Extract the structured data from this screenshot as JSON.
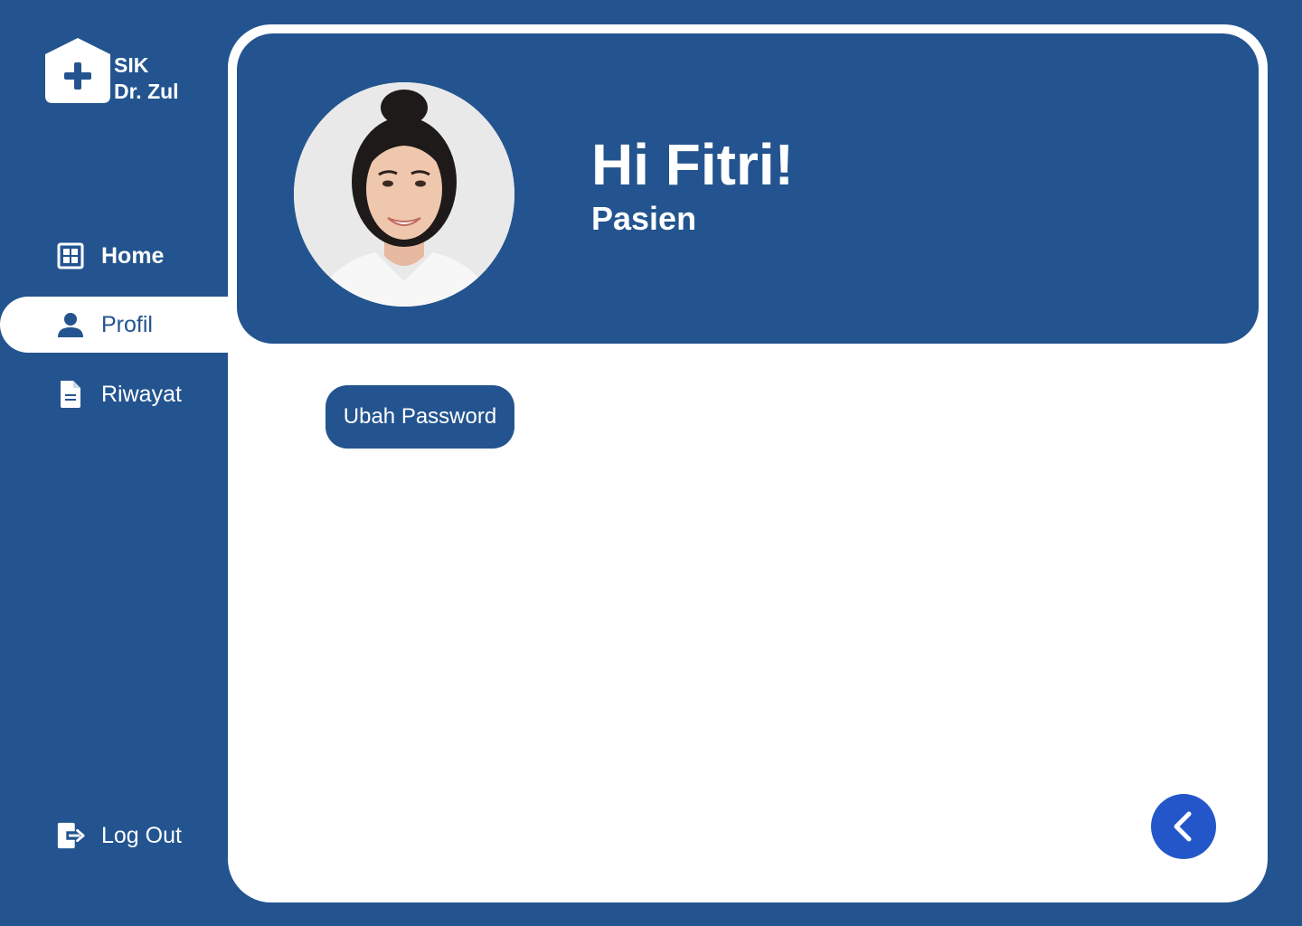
{
  "brand": {
    "line1": "SIK",
    "line2": "Dr. Zul",
    "logo_icon": "house-plus-icon"
  },
  "sidebar": {
    "items": [
      {
        "label": "Home",
        "icon": "grid-icon",
        "active": false
      },
      {
        "label": "Profil",
        "icon": "user-icon",
        "active": true
      },
      {
        "label": "Riwayat",
        "icon": "document-icon",
        "active": false
      }
    ],
    "logout": {
      "label": "Log Out",
      "icon": "logout-icon"
    }
  },
  "profile": {
    "greeting": "Hi Fitri!",
    "role": "Pasien"
  },
  "actions": {
    "change_password_label": "Ubah Password",
    "back_icon": "chevron-left-icon"
  },
  "colors": {
    "primary": "#23548F",
    "accent": "#2357C9",
    "surface": "#FFFFFF"
  }
}
